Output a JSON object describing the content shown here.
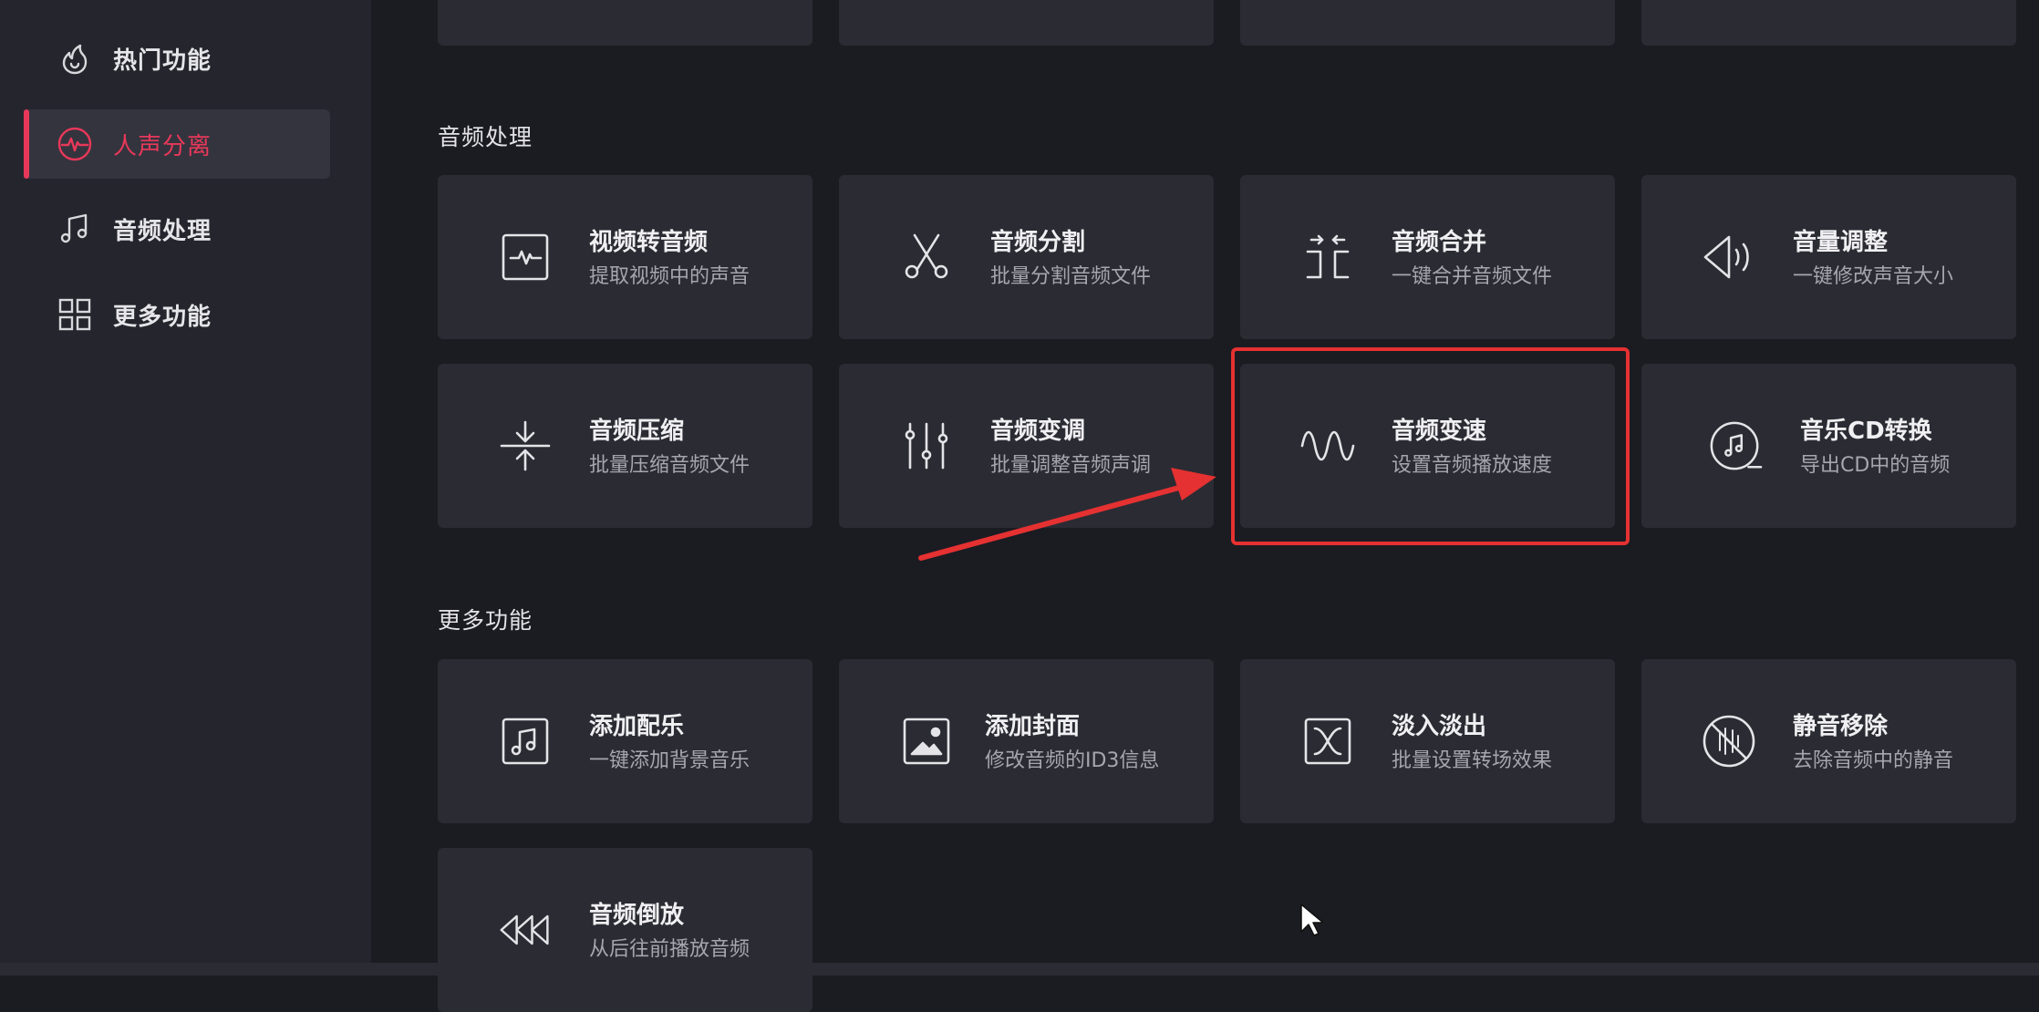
{
  "sidebar": {
    "items": [
      {
        "label": "热门功能",
        "icon": "fire-icon",
        "active": false
      },
      {
        "label": "人声分离",
        "icon": "waveform-circle-icon",
        "active": true
      },
      {
        "label": "音频处理",
        "icon": "music-note-icon",
        "active": false
      },
      {
        "label": "更多功能",
        "icon": "grid-icon",
        "active": false
      }
    ]
  },
  "sections": {
    "audio": {
      "title": "音频处理",
      "cards": [
        {
          "title": "视频转音频",
          "desc": "提取视频中的声音",
          "icon": "video-to-audio-icon"
        },
        {
          "title": "音频分割",
          "desc": "批量分割音频文件",
          "icon": "scissors-icon"
        },
        {
          "title": "音频合并",
          "desc": "一键合并音频文件",
          "icon": "merge-icon"
        },
        {
          "title": "音量调整",
          "desc": "一键修改声音大小",
          "icon": "speaker-icon"
        },
        {
          "title": "音频压缩",
          "desc": "批量压缩音频文件",
          "icon": "compress-icon"
        },
        {
          "title": "音频变调",
          "desc": "批量调整音频声调",
          "icon": "equalizer-icon"
        },
        {
          "title": "音频变速",
          "desc": "设置音频播放速度",
          "icon": "sine-wave-icon"
        },
        {
          "title": "音乐CD转换",
          "desc": "导出CD中的音频",
          "icon": "cd-music-icon"
        }
      ]
    },
    "more": {
      "title": "更多功能",
      "cards": [
        {
          "title": "添加配乐",
          "desc": "一键添加背景音乐",
          "icon": "music-square-icon"
        },
        {
          "title": "添加封面",
          "desc": "修改音频的ID3信息",
          "icon": "image-icon"
        },
        {
          "title": "淡入淡出",
          "desc": "批量设置转场效果",
          "icon": "fade-icon"
        },
        {
          "title": "静音移除",
          "desc": "去除音频中的静音",
          "icon": "mute-remove-icon"
        },
        {
          "title": "音频倒放",
          "desc": "从后往前播放音频",
          "icon": "rewind-icon"
        }
      ]
    }
  },
  "colors": {
    "accent": "#e8385a",
    "annotation": "#e53131",
    "card_bg": "#2b2b33",
    "sidebar_bg": "#25252d",
    "main_bg": "#1b1b22"
  }
}
